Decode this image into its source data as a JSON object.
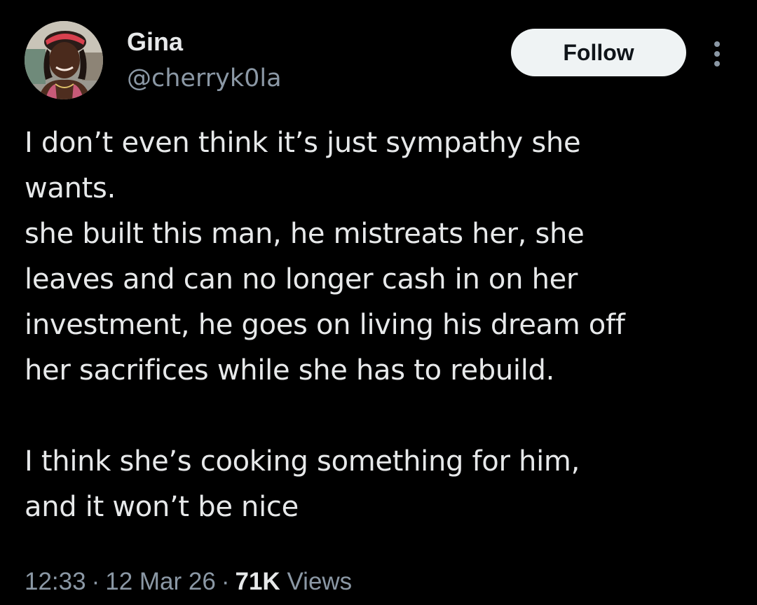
{
  "author": {
    "name": "Gina",
    "handle": "@cherryk0la"
  },
  "actions": {
    "follow_label": "Follow",
    "more_icon": "more-vertical-icon"
  },
  "tweet": {
    "lines": [
      "I don’t even think it’s just sympathy she",
      "wants.",
      "she built this man, he mistreats her, she",
      "leaves and can no longer cash in on her",
      "investment, he goes on living his dream off",
      "her sacrifices while she has to rebuild.",
      "",
      "I think she’s cooking something for him,",
      "and it won’t be nice"
    ]
  },
  "meta": {
    "time": "12:33",
    "date": "12 Mar 26",
    "views_count": "71K",
    "views_label": "Views",
    "separator": "·"
  },
  "colors": {
    "background": "#000000",
    "text_primary": "#e7e9ea",
    "text_secondary": "#8b98a5",
    "follow_bg": "#eff3f4",
    "follow_text": "#0f1419"
  }
}
